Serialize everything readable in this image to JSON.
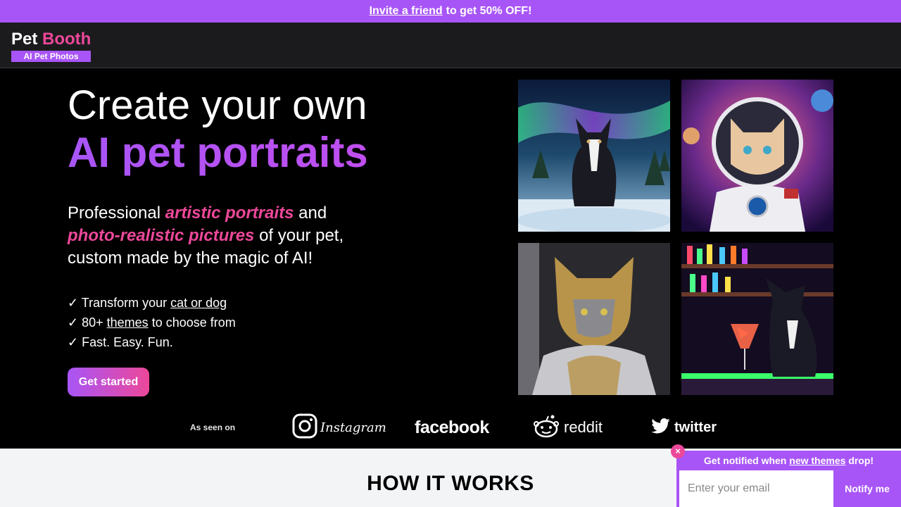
{
  "promo": {
    "link": "Invite a friend",
    "text": "to get 50% OFF!"
  },
  "logo": {
    "pet": "Pet",
    "booth": "Booth",
    "sub": "AI Pet Photos"
  },
  "hero": {
    "line1": "Create your own",
    "line2": "AI pet portraits",
    "desc": {
      "p1": "Professional",
      "em1": "artistic portraits",
      "p2": "and",
      "em2": "photo-realistic pictures",
      "p3": "of your pet, custom made by the magic of AI!"
    },
    "features": {
      "f1_pre": "✓ Transform your",
      "f1_link": "cat or dog",
      "f2_pre": "✓ 80+",
      "f2_link": "themes",
      "f2_post": "to choose from",
      "f3": "✓ Fast. Easy. Fun."
    },
    "cta": "Get started"
  },
  "gallery": {
    "tiles": [
      {
        "name": "aurora-dog"
      },
      {
        "name": "astronaut-cat"
      },
      {
        "name": "knight-cat"
      },
      {
        "name": "bar-dog"
      }
    ]
  },
  "seen_on": {
    "label": "As seen on",
    "instagram": "Instagram",
    "facebook": "facebook",
    "reddit": "reddit",
    "twitter": "twitter"
  },
  "how_it_works": {
    "title": "HOW IT WORKS"
  },
  "notify": {
    "pre": "Get notified when",
    "link": "new themes",
    "post": "drop!",
    "placeholder": "Enter your email",
    "button": "Notify me",
    "close": "×"
  },
  "colors": {
    "purple": "#a855f7",
    "pink": "#ec4899",
    "navbar": "#1b1b1e"
  }
}
